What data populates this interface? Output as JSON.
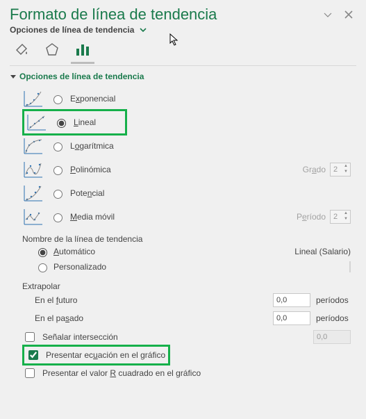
{
  "title": "Formato de línea de tendencia",
  "options_label": "Opciones de línea de tendencia",
  "section": "Opciones de línea de tendencia",
  "trend": {
    "exp": "Exponencial",
    "lin": "Lineal",
    "log": "Logarítmica",
    "poly": "Polinómica",
    "pot": "Potencial",
    "mov": "Media móvil",
    "grado_lbl": "Grado",
    "grado_val": "2",
    "periodo_lbl": "Período",
    "periodo_val": "2"
  },
  "name": {
    "header": "Nombre de la línea de tendencia",
    "auto": "Automático",
    "pers": "Personalizado",
    "auto_value": "Lineal (Salario)"
  },
  "extrap": {
    "header": "Extrapolar",
    "futuro": "En el futuro",
    "pasado": "En el pasado",
    "val": "0,0",
    "periodos": "períodos"
  },
  "checks": {
    "inter": "Señalar intersección",
    "inter_val": "0,0",
    "ecu": "Presentar ecuación en el gráfico",
    "r2": "Presentar el valor R cuadrado en el gráfico"
  }
}
